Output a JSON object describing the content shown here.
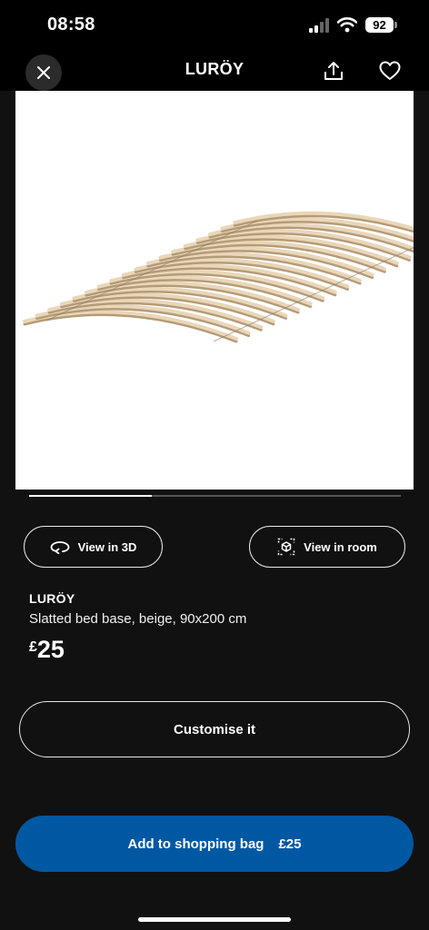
{
  "status_bar": {
    "time": "08:58",
    "battery": "92"
  },
  "header": {
    "title": "LURÖY",
    "close_icon": "close-icon",
    "share_icon": "share-icon",
    "favourite_icon": "heart-icon"
  },
  "gallery": {
    "progress": 0.33,
    "image_icon": "slatted-bed-base"
  },
  "actions": {
    "view_3d_label": "View in 3D",
    "view_3d_icon": "rotate-3d-icon",
    "view_room_label": "View in room",
    "view_room_icon": "ar-cube-icon"
  },
  "product": {
    "name": "LURÖY",
    "description": "Slatted bed base, beige, 90x200 cm",
    "currency": "£",
    "price": "25"
  },
  "customise": {
    "label": "Customise it"
  },
  "add_to_bag": {
    "label": "Add to shopping bag",
    "price": "£25"
  },
  "colors": {
    "background": "#111111",
    "primary": "#0058a3",
    "text": "#ffffff"
  }
}
